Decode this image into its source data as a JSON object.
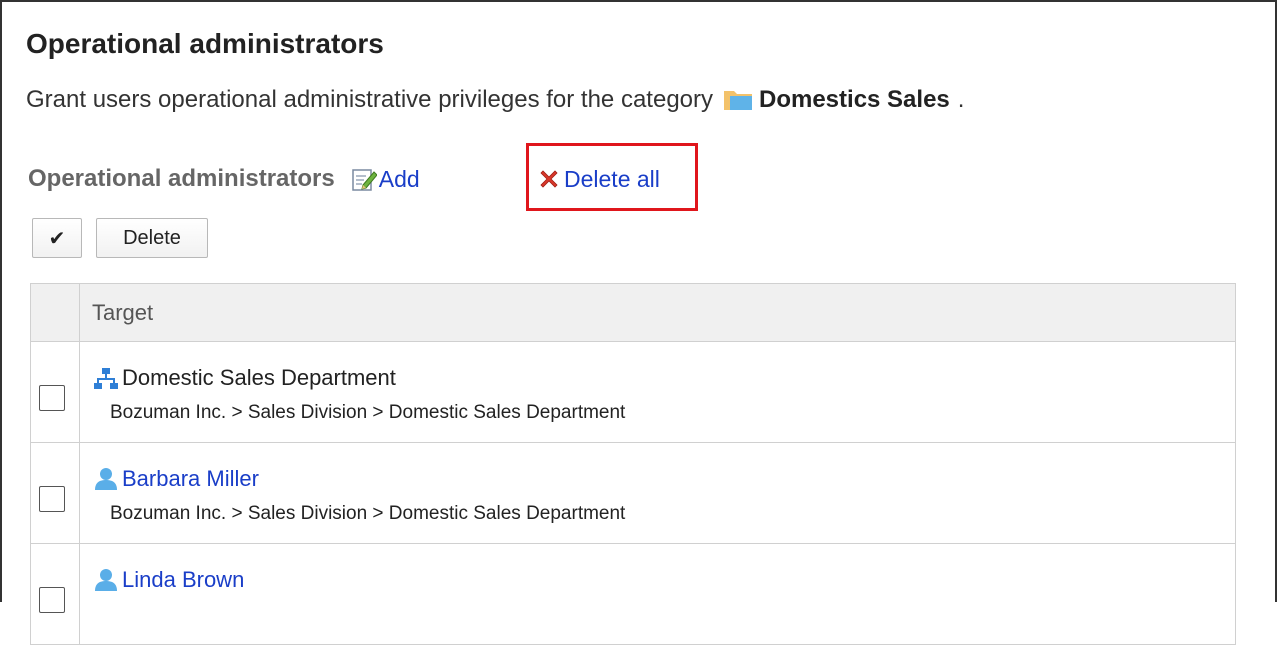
{
  "header": {
    "title": "Operational administrators",
    "description_prefix": "Grant users operational administrative privileges for the category",
    "category_name": "Domestics Sales",
    "description_suffix": "."
  },
  "section": {
    "label": "Operational administrators",
    "add_label": "Add",
    "delete_all_label": "Delete all"
  },
  "toolbar": {
    "check_all_label": "✔",
    "delete_label": "Delete"
  },
  "table": {
    "column_target": "Target",
    "rows": [
      {
        "type": "department",
        "name": "Domestic Sales Department",
        "path": "Bozuman Inc. > Sales Division > Domestic Sales Department"
      },
      {
        "type": "user",
        "name": "Barbara Miller",
        "path": "Bozuman Inc. > Sales Division > Domestic Sales Department"
      },
      {
        "type": "user",
        "name": "Linda Brown",
        "path": ""
      }
    ]
  },
  "colors": {
    "link": "#1a3ec8",
    "highlight": "#e0161c",
    "header_bg": "#f0f0f0",
    "org_icon": "#2f7fd6",
    "user_icon": "#5aaee8"
  },
  "icons": {
    "folder": "folder-icon",
    "add": "edit-pencil-icon",
    "delete_all": "red-x-icon",
    "department": "org-chart-icon",
    "user": "user-icon"
  }
}
